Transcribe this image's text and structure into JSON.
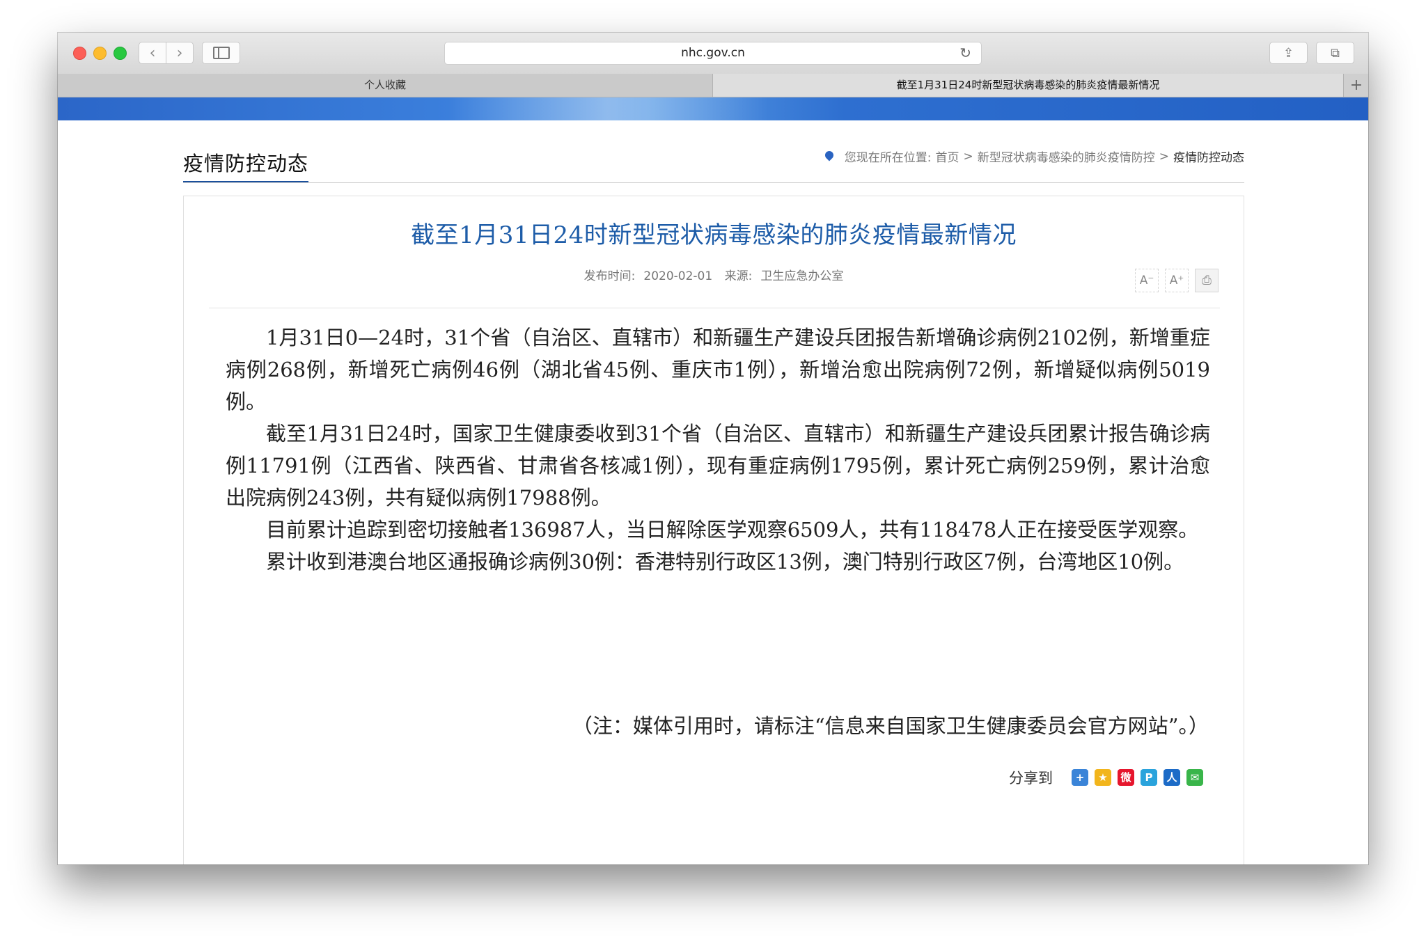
{
  "browser": {
    "url": "nhc.gov.cn",
    "tabs": [
      {
        "label": "个人收藏"
      },
      {
        "label": "截至1月31日24时新型冠状病毒感染的肺炎疫情最新情况"
      }
    ],
    "new_tab_label": "+",
    "icons": {
      "back": "‹",
      "forward": "›",
      "reload": "↻",
      "share": "⇪",
      "tabs": "⧉"
    }
  },
  "page": {
    "section_title": "疫情防控动态",
    "breadcrumb": {
      "prefix": "您现在所在位置:",
      "items": [
        "首页",
        "新型冠状病毒感染的肺炎疫情防控",
        "疫情防控动态"
      ],
      "separator": ">"
    },
    "article": {
      "title": "截至1月31日24时新型冠状病毒感染的肺炎疫情最新情况",
      "publish_label": "发布时间:",
      "publish_date": "2020-02-01",
      "source_label": "来源:",
      "source": "卫生应急办公室",
      "font_smaller_label": "A⁻",
      "font_larger_label": "A⁺",
      "print_label": "⎙",
      "paragraphs": [
        "1月31日0—24时，31个省（自治区、直辖市）和新疆生产建设兵团报告新增确诊病例2102例，新增重症病例268例，新增死亡病例46例（湖北省45例、重庆市1例），新增治愈出院病例72例，新增疑似病例5019例。",
        "截至1月31日24时，国家卫生健康委收到31个省（自治区、直辖市）和新疆生产建设兵团累计报告确诊病例11791例（江西省、陕西省、甘肃省各核减1例），现有重症病例1795例，累计死亡病例259例，累计治愈出院病例243例，共有疑似病例17988例。",
        "目前累计追踪到密切接触者136987人，当日解除医学观察6509人，共有118478人正在接受医学观察。",
        "累计收到港澳台地区通报确诊病例30例：香港特别行政区13例，澳门特别行政区7例，台湾地区10例。"
      ],
      "note": "（注：媒体引用时，请标注“信息来自国家卫生健康委员会官方网站”。）",
      "share_label": "分享到",
      "share_icons": [
        {
          "name": "more",
          "glyph": "+",
          "color": "#3a84d8"
        },
        {
          "name": "qzone",
          "glyph": "★",
          "color": "#f2b51c"
        },
        {
          "name": "weibo",
          "glyph": "微",
          "color": "#e6162d"
        },
        {
          "name": "tencent-weibo",
          "glyph": "P",
          "color": "#2aa3dc"
        },
        {
          "name": "renren",
          "glyph": "人",
          "color": "#1c6bc7"
        },
        {
          "name": "wechat",
          "glyph": "✉",
          "color": "#39b54a"
        }
      ]
    }
  }
}
